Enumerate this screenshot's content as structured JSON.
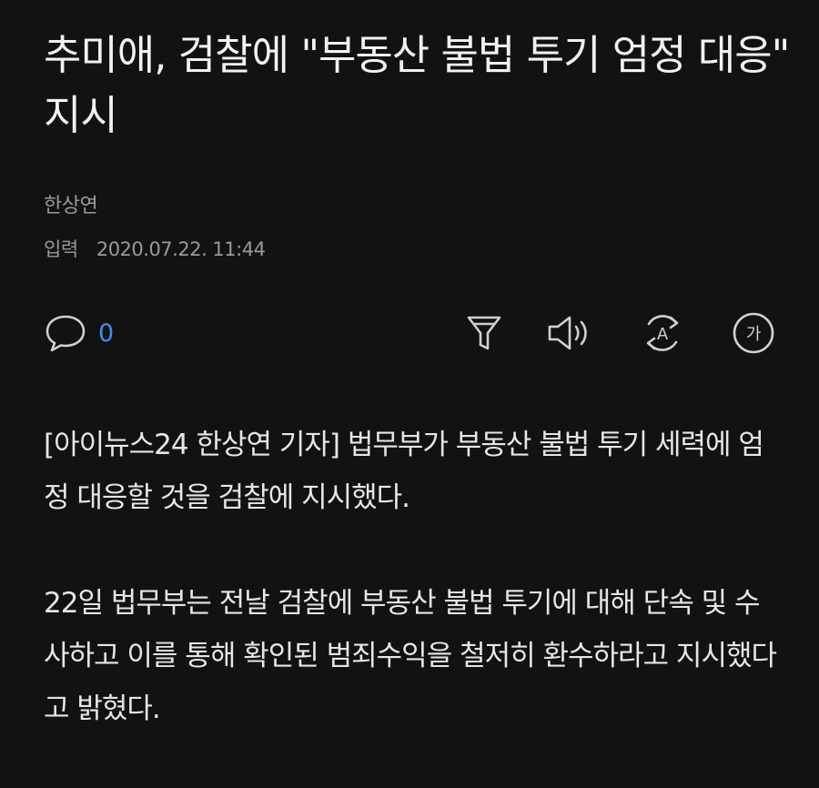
{
  "article": {
    "title": "추미애, 검찰에 \"부동산 불법 투기 엄정 대응\" 지시",
    "author": "한상연",
    "date_label": "입력",
    "date": "2020.07.22. 11:44",
    "comment_count": "0",
    "paragraphs": [
      "[아이뉴스24 한상연 기자] 법무부가 부동산 불법 투기 세력에 엄정 대응할 것을 검찰에 지시했다.",
      "22일 법무부는 전날 검찰에 부동산 불법 투기에 대해 단속 및 수사하고 이를 통해 확인된 범죄수익을 철저히 환수하라고 지시했다고 밝혔다."
    ]
  },
  "toolbar": {
    "icons": {
      "comment": "speech-bubble-icon",
      "filter": "funnel-icon",
      "listen": "speaker-icon",
      "translate": "translate-icon",
      "font_size": "font-size-icon"
    },
    "font_size_glyph": "가",
    "translate_glyph": "A"
  },
  "colors": {
    "background": "#121212",
    "text": "#e6e6e6",
    "muted": "#9a9a9a",
    "accent": "#3d8ff2",
    "icon": "#d0d0d0"
  }
}
